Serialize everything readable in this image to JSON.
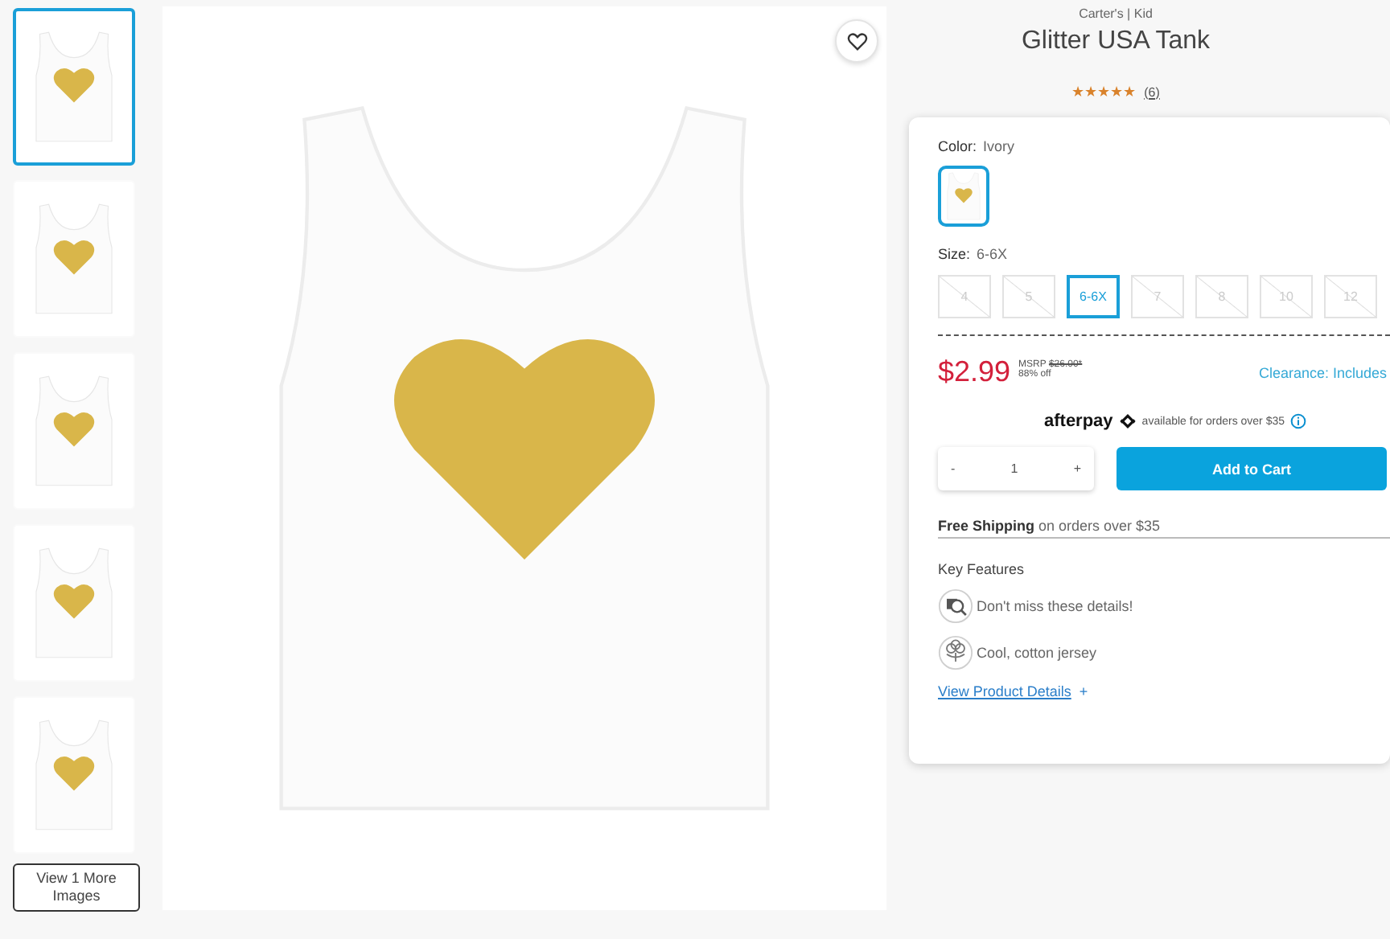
{
  "thumbnails": [
    {
      "selected": true
    },
    {
      "selected": false
    },
    {
      "selected": false
    },
    {
      "selected": false
    },
    {
      "selected": false
    }
  ],
  "view_more_button": "View 1 More Images",
  "brand": "Carter's | Kid",
  "title": "Glitter USA Tank",
  "rating": {
    "stars": 5,
    "count": "(6)"
  },
  "color": {
    "label": "Color:",
    "value": "Ivory",
    "swatches": [
      {
        "selected": true
      }
    ]
  },
  "size": {
    "label": "Size:",
    "value": "6-6X",
    "options": [
      {
        "label": "4",
        "selected": false,
        "disabled": true
      },
      {
        "label": "5",
        "selected": false,
        "disabled": true
      },
      {
        "label": "6-6X",
        "selected": true,
        "disabled": false
      },
      {
        "label": "7",
        "selected": false,
        "disabled": true
      },
      {
        "label": "8",
        "selected": false,
        "disabled": true
      },
      {
        "label": "10",
        "selected": false,
        "disabled": true
      },
      {
        "label": "12",
        "selected": false,
        "disabled": true
      }
    ]
  },
  "price": {
    "sale": "$2.99",
    "msrp_label": "MSRP",
    "msrp": "$26.00*",
    "discount": "88% off",
    "promo": "Clearance: Includes"
  },
  "afterpay": {
    "logo": "afterpay",
    "text": "available for orders over $35"
  },
  "quantity": {
    "decrement": "-",
    "value": "1",
    "increment": "+"
  },
  "add_to_cart": "Add to Cart",
  "shipping": "**Free Shipping** on orders over $35",
  "key_features": {
    "heading": "Key Features",
    "items": [
      {
        "kind": "details",
        "text": "Don't miss these details!"
      },
      {
        "kind": "cotton",
        "text": "Cool, cotton jersey"
      }
    ]
  },
  "details_link": {
    "label": "View Product Details",
    "icon": "+"
  }
}
